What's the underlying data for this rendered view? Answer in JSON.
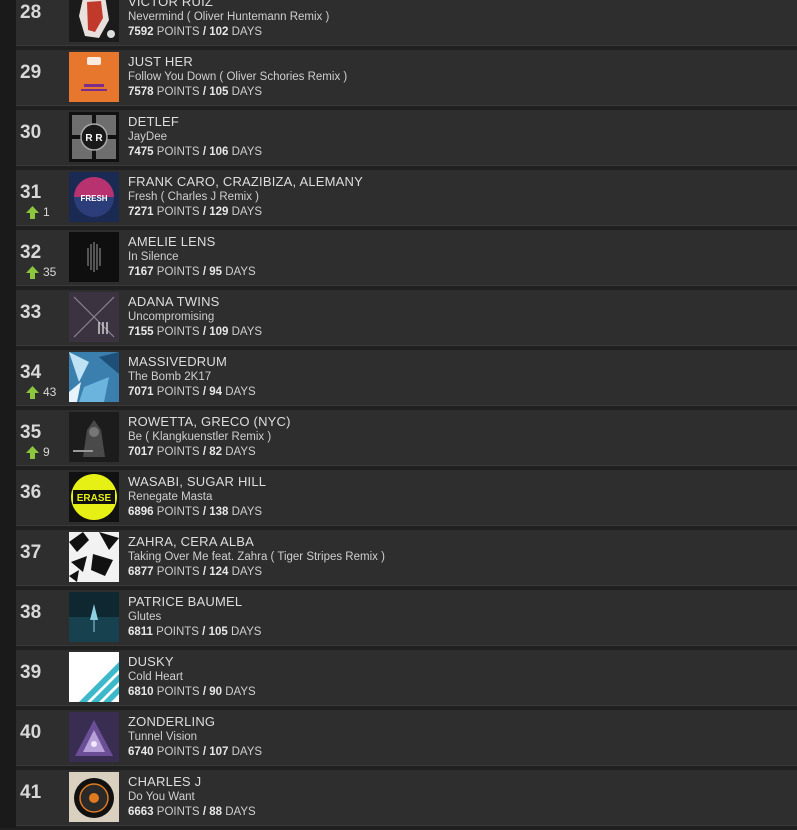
{
  "points_label": "POINTS",
  "days_label": "DAYS",
  "separator": "/",
  "colors": {
    "row_bg": "#2e2e2e",
    "page_bg": "#202020",
    "trend_up": "#8cc63f"
  },
  "tracks": [
    {
      "rank": "28",
      "artist": "VICTOR RUIZ",
      "title": "Nevermind ( Oliver Huntemann Remix )",
      "points": "7592",
      "days": "102",
      "trend": null,
      "cover": "cover-victor-ruiz"
    },
    {
      "rank": "29",
      "artist": "JUST HER",
      "title": "Follow You Down ( Oliver Schories Remix )",
      "points": "7578",
      "days": "105",
      "trend": null,
      "cover": "cover-just-her"
    },
    {
      "rank": "30",
      "artist": "DETLEF",
      "title": "JayDee",
      "points": "7475",
      "days": "106",
      "trend": null,
      "cover": "cover-detlef"
    },
    {
      "rank": "31",
      "artist": "FRANK CARO, CRAZIBIZA, ALEMANY",
      "title": "Fresh ( Charles J Remix )",
      "points": "7271",
      "days": "129",
      "trend": "1",
      "cover": "cover-fresh"
    },
    {
      "rank": "32",
      "artist": "AMELIE LENS",
      "title": "In Silence",
      "points": "7167",
      "days": "95",
      "trend": "35",
      "cover": "cover-amelie-lens"
    },
    {
      "rank": "33",
      "artist": "ADANA TWINS",
      "title": "Uncompromising",
      "points": "7155",
      "days": "109",
      "trend": null,
      "cover": "cover-adana-twins"
    },
    {
      "rank": "34",
      "artist": "MASSIVEDRUM",
      "title": "The Bomb 2K17",
      "points": "7071",
      "days": "94",
      "trend": "43",
      "cover": "cover-massivedrum"
    },
    {
      "rank": "35",
      "artist": "ROWETTA, GRECO (NYC)",
      "title": "Be ( Klangkuenstler Remix )",
      "points": "7017",
      "days": "82",
      "trend": "9",
      "cover": "cover-rowetta"
    },
    {
      "rank": "36",
      "artist": "WASABI, SUGAR HILL",
      "title": "Renegate Masta",
      "points": "6896",
      "days": "138",
      "trend": null,
      "cover": "cover-erase"
    },
    {
      "rank": "37",
      "artist": "ZAHRA, CERA ALBA",
      "title": "Taking Over Me feat. Zahra ( Tiger Stripes Remix )",
      "points": "6877",
      "days": "124",
      "trend": null,
      "cover": "cover-zahra"
    },
    {
      "rank": "38",
      "artist": "PATRICE BAUMEL",
      "title": "Glutes",
      "points": "6811",
      "days": "105",
      "trend": null,
      "cover": "cover-patrice-baumel"
    },
    {
      "rank": "39",
      "artist": "DUSKY",
      "title": "Cold Heart",
      "points": "6810",
      "days": "90",
      "trend": null,
      "cover": "cover-dusky"
    },
    {
      "rank": "40",
      "artist": "ZONDERLING",
      "title": "Tunnel Vision",
      "points": "6740",
      "days": "107",
      "trend": null,
      "cover": "cover-zonderling"
    },
    {
      "rank": "41",
      "artist": "CHARLES J",
      "title": "Do You Want",
      "points": "6663",
      "days": "88",
      "trend": null,
      "cover": "cover-charles-j"
    }
  ]
}
